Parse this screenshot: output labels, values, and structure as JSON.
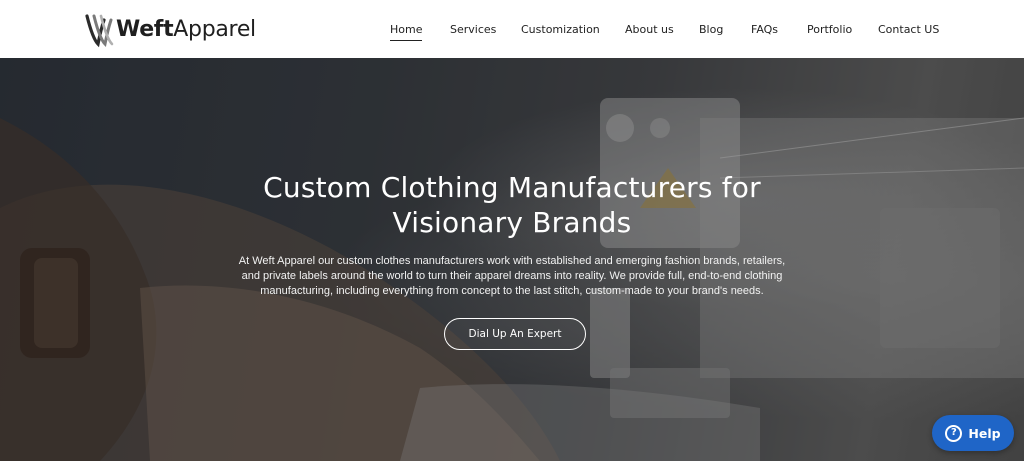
{
  "brand": {
    "name_bold": "W",
    "name_rest": "eft",
    "name_suffix": "Apparel"
  },
  "nav": {
    "items": [
      {
        "label": "Home",
        "active": true
      },
      {
        "label": "Services",
        "active": false
      },
      {
        "label": "Customization",
        "active": false
      },
      {
        "label": "About us",
        "active": false
      },
      {
        "label": "Blog",
        "active": false
      },
      {
        "label": "FAQs",
        "active": false
      },
      {
        "label": "Portfolio",
        "active": false
      },
      {
        "label": "Contact US",
        "active": false
      }
    ]
  },
  "hero": {
    "title_line1": "Custom Clothing Manufacturers for",
    "title_line2": "Visionary Brands",
    "description_line1": "At Weft Apparel our custom clothes manufacturers work with established and emerging fashion brands, retailers,",
    "description_line2": "and private labels around the world to turn their apparel dreams into reality. We provide full, end-to-end clothing",
    "description_line3": "manufacturing, including everything from concept to the last stitch, custom-made to your brand's needs.",
    "cta_label": "Dial Up An Expert"
  },
  "help_widget": {
    "label": "Help",
    "icon": "question-circle-icon",
    "color": "#1f65c7"
  }
}
